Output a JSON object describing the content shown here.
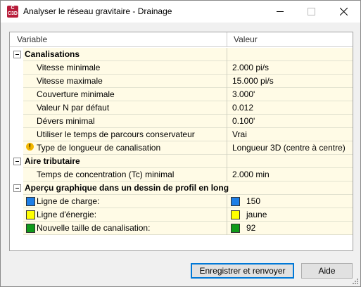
{
  "window": {
    "title": "Analyser le réseau gravitaire - Drainage",
    "app_icon_text": "C\nC3D"
  },
  "grid": {
    "col_variable": "Variable",
    "col_value": "Valeur",
    "categories": [
      {
        "label": "Canalisations",
        "rows": [
          {
            "label": "Vitesse minimale",
            "value": "2.000 pi/s"
          },
          {
            "label": "Vitesse maximale",
            "value": "15.000 pi/s"
          },
          {
            "label": "Couverture minimale",
            "value": "3.000'"
          },
          {
            "label": "Valeur N par défaut",
            "value": "0.012"
          },
          {
            "label": "Dévers minimal",
            "value": "0.100'"
          },
          {
            "label": "Utiliser le temps de parcours conservateur",
            "value": "Vrai"
          },
          {
            "label": "Type de longueur de canalisation",
            "value": "Longueur 3D (centre à centre)",
            "icon": "warning-icon"
          }
        ]
      },
      {
        "label": "Aire tributaire",
        "rows": [
          {
            "label": "Temps de concentration (Tc) minimal",
            "value": "2.000 min"
          }
        ]
      },
      {
        "label": "Aperçu graphique dans un dessin de profil en long",
        "rows": [
          {
            "label": "Ligne de charge:",
            "value": "150",
            "color": "#1e7fe6"
          },
          {
            "label": "Ligne d'énergie:",
            "value": "jaune",
            "color": "#ffff00"
          },
          {
            "label": "Nouvelle taille de canalisation:",
            "value": "92",
            "color": "#0f9b19"
          }
        ]
      }
    ]
  },
  "buttons": {
    "save": "Enregistrer et renvoyer",
    "help": "Aide"
  }
}
